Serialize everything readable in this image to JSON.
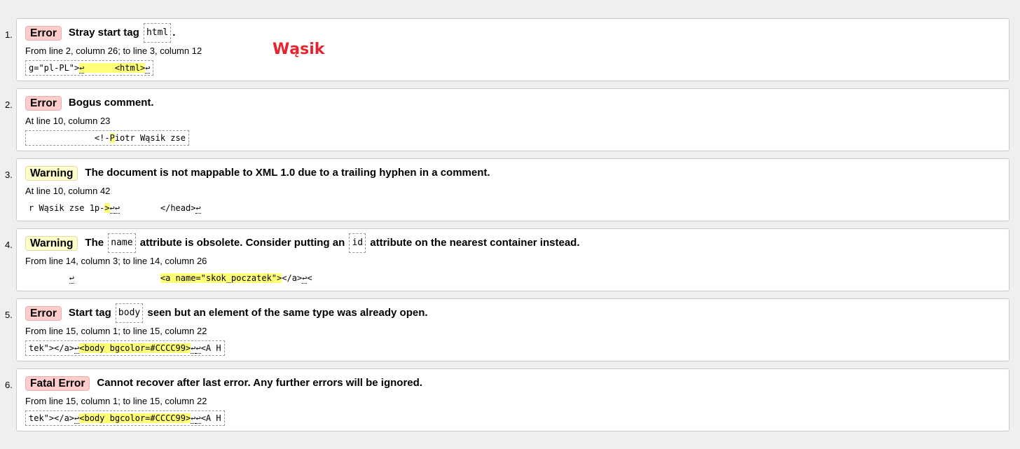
{
  "overlay_text": "Wąsik",
  "messages": [
    {
      "num": "1.",
      "type": "error",
      "badge": "Error",
      "parts": [
        {
          "t": "Stray start tag "
        },
        {
          "c": "html"
        },
        {
          "t": "."
        }
      ],
      "location": "From line 2, column 26; to line 3, column 12",
      "extract_bordered": true,
      "extract": [
        {
          "t": "g=\"pl-PL\">"
        },
        {
          "h": "↩      <html>"
        },
        {
          "t": "↩"
        }
      ]
    },
    {
      "num": "2.",
      "type": "error",
      "badge": "Error",
      "parts": [
        {
          "t": "Bogus comment."
        }
      ],
      "location": "At line 10, column 23",
      "extract_bordered": true,
      "extract": [
        {
          "t": "             <!-"
        },
        {
          "h": "P"
        },
        {
          "t": "iotr Wąsik zse"
        }
      ]
    },
    {
      "num": "3.",
      "type": "warning",
      "badge": "Warning",
      "parts": [
        {
          "t": "The document is not mappable to XML 1.0 due to a trailing hyphen in a comment."
        }
      ],
      "location": "At line 10, column 42",
      "extract_bordered": false,
      "extract": [
        {
          "t": "r Wąsik zse 1p-"
        },
        {
          "h": ">"
        },
        {
          "t": "↩↩        </head>↩"
        }
      ]
    },
    {
      "num": "4.",
      "type": "warning",
      "badge": "Warning",
      "parts": [
        {
          "t": "The "
        },
        {
          "c": "name"
        },
        {
          "t": " attribute is obsolete. Consider putting an "
        },
        {
          "c": "id"
        },
        {
          "t": " attribute on the nearest container instead."
        }
      ],
      "location": "From line 14, column 3; to line 14, column 26",
      "extract_bordered": false,
      "extract": [
        {
          "t": "        ↩                 "
        },
        {
          "h": "<a name=\"skok_poczatek\">"
        },
        {
          "t": "</a>↩<"
        }
      ]
    },
    {
      "num": "5.",
      "type": "error",
      "badge": "Error",
      "parts": [
        {
          "t": "Start tag "
        },
        {
          "c": "body"
        },
        {
          "t": " seen but an element of the same type was already open."
        }
      ],
      "location": "From line 15, column 1; to line 15, column 22",
      "extract_bordered": true,
      "extract": [
        {
          "t": "tek\"></a>↩"
        },
        {
          "h": "<body bgcolor=#CCCC99>"
        },
        {
          "t": "↩↩<A H"
        }
      ]
    },
    {
      "num": "6.",
      "type": "error",
      "badge": "Fatal Error",
      "parts": [
        {
          "t": "Cannot recover after last error. Any further errors will be ignored."
        }
      ],
      "location": "From line 15, column 1; to line 15, column 22",
      "extract_bordered": true,
      "extract": [
        {
          "t": "tek\"></a>↩"
        },
        {
          "h": "<body bgcolor=#CCCC99>"
        },
        {
          "t": "↩↩<A H"
        }
      ]
    }
  ]
}
